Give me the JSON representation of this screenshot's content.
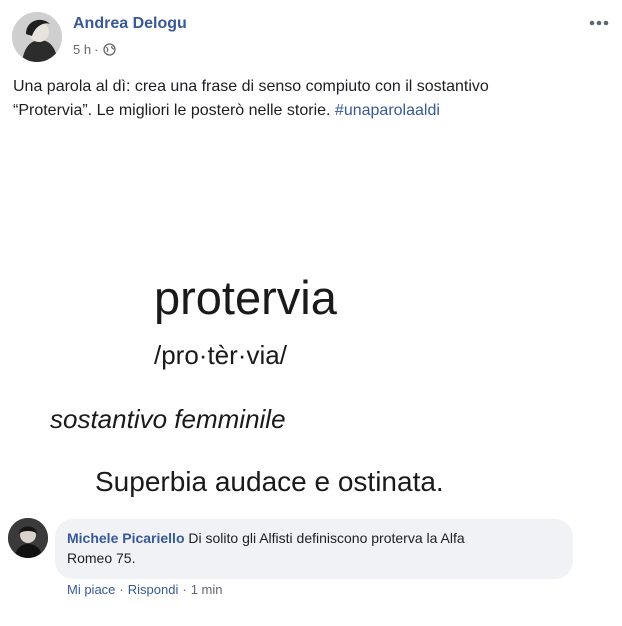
{
  "post": {
    "author": "Andrea Delogu",
    "time": "5 h",
    "separator": "·",
    "text_line1": "Una parola al dì: crea una frase di senso compiuto con il sostantivo",
    "text_line2": "“Protervia”. Le migliori le posterò nelle storie.",
    "hashtag": "#unaparolaaldi",
    "privacy_icon": "globe-icon",
    "more_icon": "more-options-icon"
  },
  "image": {
    "word": "protervia",
    "pronunciation": "/pro·tèr·via/",
    "part_of_speech": "sostantivo femminile",
    "definition": "Superbia audace e ostinata."
  },
  "comment": {
    "author": "Michele Picariello",
    "text_line1": "Di solito gli Alfisti definiscono proterva la Alfa",
    "text_line2": "Romeo 75.",
    "like": "Mi piace",
    "reply": "Rispondi",
    "separator": "·",
    "time": "1 min"
  },
  "colors": {
    "link": "#385898",
    "meta": "#65676b",
    "bubble": "#f0f2f5"
  }
}
